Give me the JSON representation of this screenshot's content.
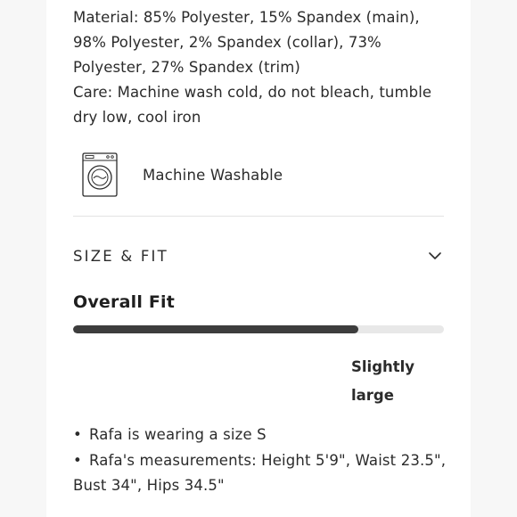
{
  "details": {
    "material_line1": "Material: 85% Polyester, 15% Spandex (main),",
    "material_line2": "98% Polyester, 2% Spandex (collar), 73%",
    "material_line3": "Polyester, 27% Spandex (trim)",
    "care_line1": "Care: Machine wash cold, do not bleach, tumble",
    "care_line2": "dry low, cool iron"
  },
  "care_badge": {
    "icon": "washing-machine-icon",
    "label": "Machine Washable"
  },
  "size_fit": {
    "header": "SIZE & FIT",
    "expand_icon": "chevron-down-icon",
    "overall_fit_title": "Overall Fit",
    "fit_level_fraction": 0.77,
    "fit_label_line1": "Slightly",
    "fit_label_line2": "large",
    "bullet_glyph": "•",
    "bullets": [
      {
        "line1": "Rafa is wearing a size S"
      },
      {
        "line1": "Rafa's measurements: Height 5'9\", Waist 23.5\",",
        "line2": "Bust 34\", Hips 34.5\""
      }
    ]
  },
  "colors": {
    "text": "#2b2b2b",
    "fit_bar_fill": "#3d3d3d",
    "fit_bar_track": "#e8e8e8",
    "divider": "#e3e3e3"
  }
}
